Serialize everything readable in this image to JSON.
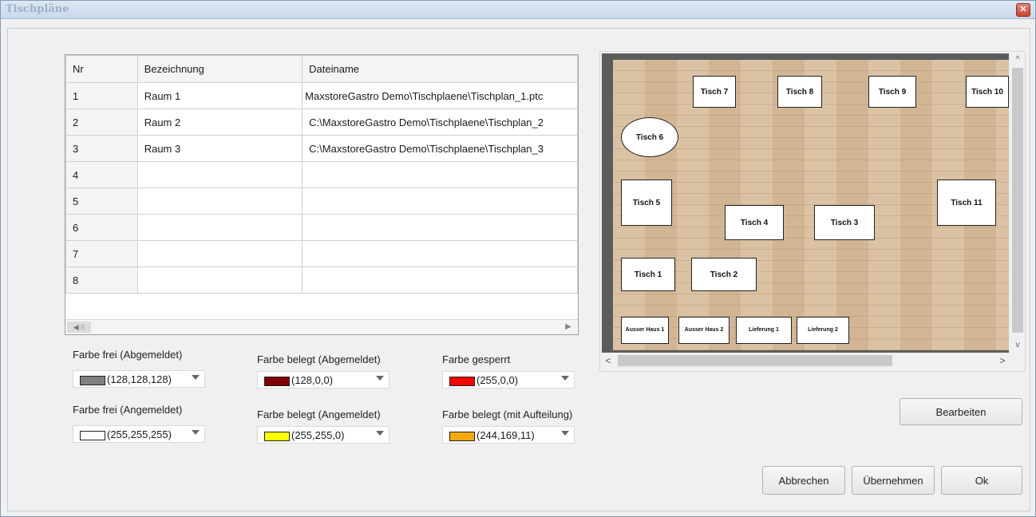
{
  "window": {
    "title": "Tischpläne",
    "close_glyph": "✕"
  },
  "grid": {
    "columns": [
      "Nr",
      "Bezeichnung",
      "Dateiname"
    ],
    "rows": [
      {
        "nr": "1",
        "name": "Raum 1",
        "file": "MaxstoreGastro Demo\\Tischplaene\\Tischplan_1.ptc"
      },
      {
        "nr": "2",
        "name": "Raum 2",
        "file": "C:\\MaxstoreGastro Demo\\Tischplaene\\Tischplan_2"
      },
      {
        "nr": "3",
        "name": "Raum 3",
        "file": "C:\\MaxstoreGastro Demo\\Tischplaene\\Tischplan_3"
      },
      {
        "nr": "4",
        "name": "",
        "file": ""
      },
      {
        "nr": "5",
        "name": "",
        "file": ""
      },
      {
        "nr": "6",
        "name": "",
        "file": ""
      },
      {
        "nr": "7",
        "name": "",
        "file": ""
      },
      {
        "nr": "8",
        "name": "",
        "file": ""
      }
    ]
  },
  "colors": [
    {
      "label": "Farbe frei (Abgemeldet)",
      "value": "(128,128,128)",
      "hex": "#808080"
    },
    {
      "label": "Farbe belegt (Abgemeldet)",
      "value": "(128,0,0)",
      "hex": "#800000"
    },
    {
      "label": "Farbe gesperrt",
      "value": "(255,0,0)",
      "hex": "#ff0000"
    },
    {
      "label": "Farbe frei (Angemeldet)",
      "value": "(255,255,255)",
      "hex": "#ffffff"
    },
    {
      "label": "Farbe belegt (Angemeldet)",
      "value": "(255,255,0)",
      "hex": "#ffff00"
    },
    {
      "label": "Farbe belegt (mit Aufteilung)",
      "value": "(244,169,11)",
      "hex": "#f4a90b"
    }
  ],
  "tables": {
    "t7": "Tisch 7",
    "t8": "Tisch 8",
    "t9": "Tisch 9",
    "t10": "Tisch 10",
    "t6": "Tisch 6",
    "t5": "Tisch 5",
    "t11": "Tisch 11",
    "t4": "Tisch 4",
    "t3": "Tisch 3",
    "t1": "Tisch 1",
    "t2": "Tisch 2",
    "ah1": "Ausser Haus 1",
    "ah2": "Ausser Haus 2",
    "l1": "Lieferung 1",
    "l2": "Lieferung 2"
  },
  "buttons": {
    "edit": "Bearbeiten",
    "cancel": "Abbrechen",
    "apply": "Übernehmen",
    "ok": "Ok"
  }
}
